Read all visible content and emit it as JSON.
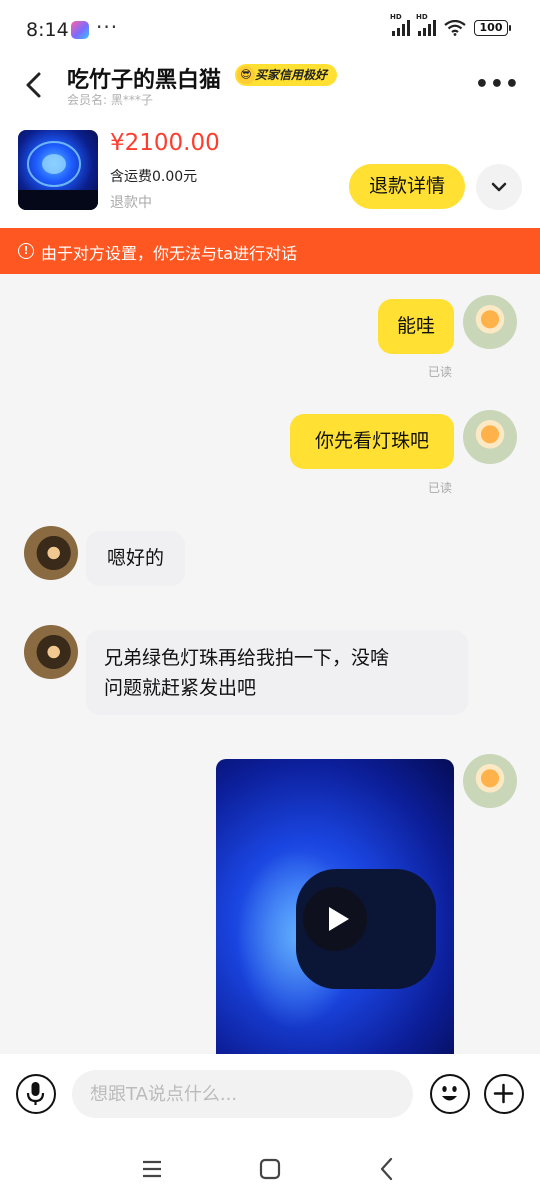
{
  "status_bar": {
    "time": "8:14",
    "dots": "···",
    "battery": "100"
  },
  "header": {
    "title": "吃竹子的黑白猫",
    "credit_badge": "买家信用极好",
    "member_label": "会员名:",
    "member_name": "黑***子"
  },
  "order": {
    "price": "¥2100.00",
    "shipping": "含运费0.00元",
    "status": "退款中",
    "refund_button": "退款详情"
  },
  "notice": {
    "text": "由于对方设置，你无法与ta进行对话"
  },
  "messages": [
    {
      "side": "out",
      "text": "能哇",
      "read": "已读"
    },
    {
      "side": "out",
      "text": "你先看灯珠吧",
      "read": "已读"
    },
    {
      "side": "in",
      "text": "嗯好的"
    },
    {
      "side": "in",
      "line1": "兄弟绿色灯珠再给我拍一下，没啥",
      "line2": "问题就赶紧发出吧"
    },
    {
      "side": "out",
      "type": "video"
    }
  ],
  "input": {
    "placeholder": "想跟TA说点什么..."
  },
  "colors": {
    "accent": "#ffe033",
    "notice": "#ff5722",
    "price": "#ff3d2e"
  }
}
